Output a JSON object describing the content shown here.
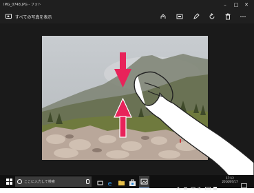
{
  "window": {
    "title": "IMG_0748.JPG - フォト",
    "minimize_icon": "minimize-icon",
    "maximize_icon": "maximize-icon",
    "close_icon": "close-icon"
  },
  "toolbar": {
    "all_photos_label": "すべての写真を表示",
    "icons": [
      "share-icon",
      "slideshow-icon",
      "edit-pencil-icon",
      "rotate-icon",
      "delete-icon",
      "more-icon"
    ]
  },
  "taskbar": {
    "search_placeholder": "ここに入力して検索",
    "clock_time": "17:12",
    "clock_date": "2016/07/17",
    "pinned_icons": [
      "task-view-icon",
      "edge-icon",
      "file-explorer-icon",
      "store-icon",
      "photos-icon"
    ]
  },
  "overlay": {
    "gesture": "pinch-zoom-out",
    "arrow_color": "#e8235a"
  }
}
